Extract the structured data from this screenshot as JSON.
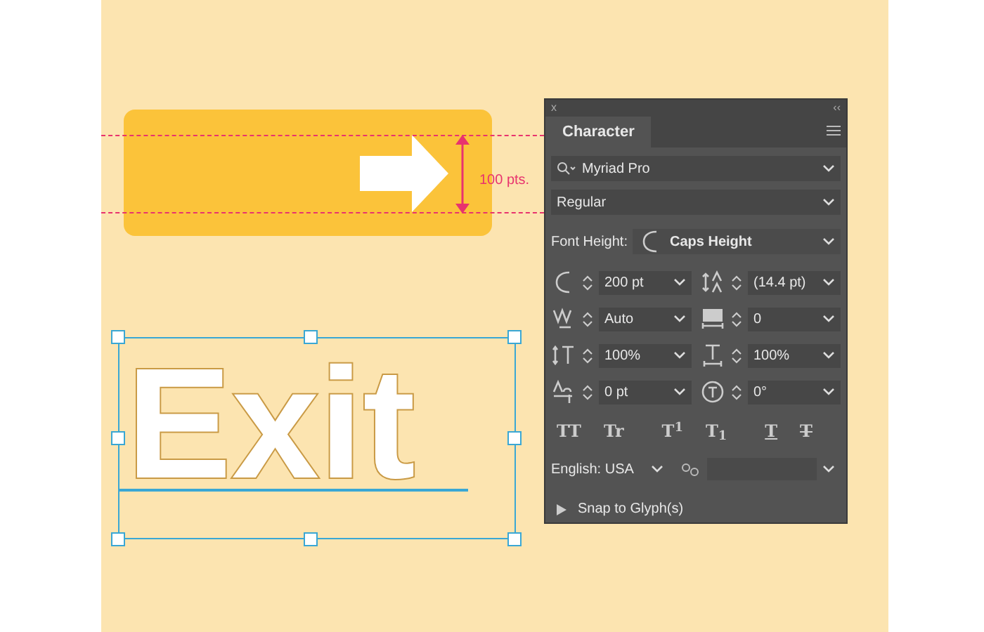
{
  "canvas": {
    "measurement_label": "100 pts.",
    "sample_text": "Exit"
  },
  "panel": {
    "close": "x",
    "collapse": "‹‹",
    "tab": {
      "label": "Character",
      "selected": true
    },
    "font_family": "Myriad Pro",
    "font_style": "Regular",
    "font_height": {
      "label": "Font Height:",
      "value": "Caps Height"
    },
    "fields": [
      {
        "kind": "size",
        "value": "200 pt"
      },
      {
        "kind": "leading",
        "value": "(14.4 pt)"
      },
      {
        "kind": "kerning",
        "value": "Auto"
      },
      {
        "kind": "tracking",
        "value": "0"
      },
      {
        "kind": "vscale",
        "value": "100%"
      },
      {
        "kind": "hscale",
        "value": "100%"
      },
      {
        "kind": "baseline",
        "value": "0 pt"
      },
      {
        "kind": "rotate",
        "value": "0°"
      }
    ],
    "style_buttons": [
      {
        "kind": "plain",
        "label": "TT"
      },
      {
        "kind": "plain",
        "label": "Tr"
      },
      {
        "kind": "plain",
        "label": "T$^{1}$"
      },
      {
        "kind": "plain",
        "label": "T$_{1}$"
      },
      {
        "kind": "underline",
        "label": "T"
      },
      {
        "kind": "strike",
        "label": "T"
      }
    ],
    "language": "English: USA",
    "snap": {
      "label": "Snap to Glyph(s)",
      "expanded": false
    }
  }
}
